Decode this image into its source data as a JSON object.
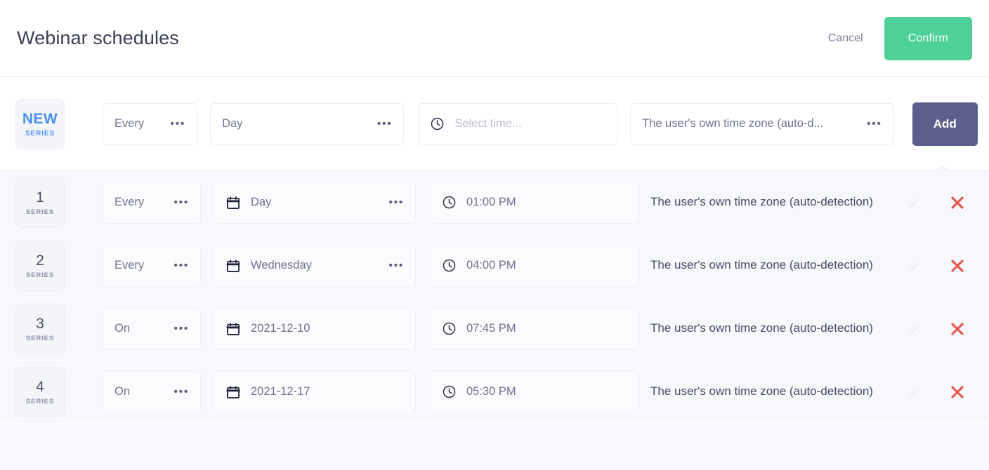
{
  "header": {
    "title": "Webinar schedules",
    "cancel_label": "Cancel",
    "confirm_label": "Confirm",
    "confirm_color": "#4ed197"
  },
  "composer": {
    "badge_main": "NEW",
    "badge_sub": "SERIES",
    "badge_color": "#4a90f0",
    "recurrence": "Every",
    "when": "Day",
    "time_placeholder": "Select time...",
    "timezone": "The user's own time zone (auto-d...",
    "add_label": "Add",
    "add_color": "#5b5f8c",
    "dots": "•••"
  },
  "rows": [
    {
      "num": "1",
      "sub": "SERIES",
      "recurrence": "Every",
      "when": "Day",
      "time": "01:00 PM",
      "timezone": "The user's own time zone (auto-detection)",
      "has_when_dots": true
    },
    {
      "num": "2",
      "sub": "SERIES",
      "recurrence": "Every",
      "when": "Wednesday",
      "time": "04:00 PM",
      "timezone": "The user's own time zone (auto-detection)",
      "has_when_dots": true
    },
    {
      "num": "3",
      "sub": "SERIES",
      "recurrence": "On",
      "when": "2021-12-10",
      "time": "07:45 PM",
      "timezone": "The user's own time zone (auto-detection)",
      "has_when_dots": false
    },
    {
      "num": "4",
      "sub": "SERIES",
      "recurrence": "On",
      "when": "2021-12-17",
      "time": "05:30 PM",
      "timezone": "The user's own time zone (auto-detection)",
      "has_when_dots": false
    }
  ],
  "icons": {
    "clock": "clock-icon",
    "calendar": "calendar-icon",
    "edit": "pencil-icon",
    "delete": "close-icon",
    "dots": "more-dots-icon"
  },
  "colors": {
    "list_background": "#f7f8fc",
    "delete": "#e4594f",
    "text": "#464b63"
  }
}
